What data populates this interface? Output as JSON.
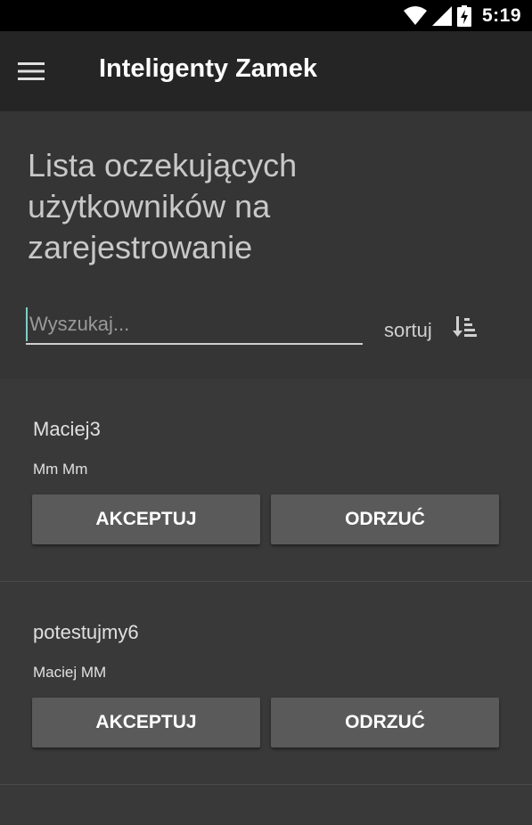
{
  "status_bar": {
    "time": "5:19",
    "icons": [
      "wifi-icon",
      "cell-signal-icon",
      "battery-charging-icon"
    ]
  },
  "app_bar": {
    "menu_icon": "hamburger-menu-icon",
    "title": "Inteligenty Zamek"
  },
  "header": {
    "title": "Lista oczekujących użytkowników na zarejestrowanie",
    "search": {
      "placeholder": "Wyszukaj...",
      "value": ""
    },
    "sort_label": "sortuj",
    "sort_icon": "sort-ascending-icon"
  },
  "users": [
    {
      "login": "Maciej3",
      "name": "Mm Mm",
      "accept_label": "AKCEPTUJ",
      "reject_label": "ODRZUĆ"
    },
    {
      "login": "potestujmy6",
      "name": "Maciej MM",
      "accept_label": "AKCEPTUJ",
      "reject_label": "ODRZUĆ"
    }
  ],
  "colors": {
    "status_bar": "#000000",
    "app_bar": "#252525",
    "header_panel": "#353535",
    "background": "#393939",
    "button": "#5a5a5a",
    "cursor_accent": "#7ecfc4"
  }
}
